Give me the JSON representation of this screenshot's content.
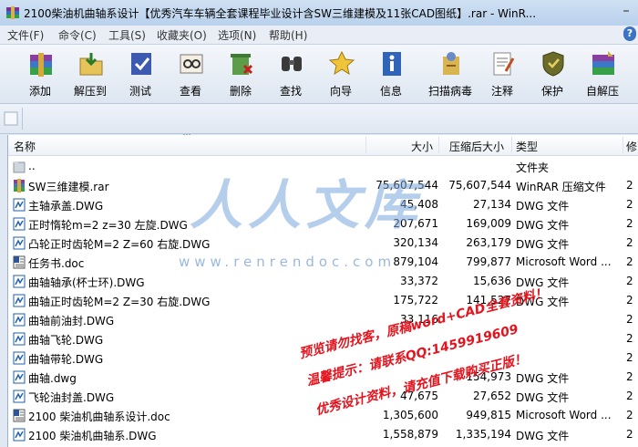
{
  "window": {
    "title": "2100柴油机曲轴系设计【优秀汽车车辆全套课程毕业设计含SW三维建模及11张CAD图纸】.rar - WinR..."
  },
  "menu": {
    "items": [
      "文件(F)",
      "命令(C)",
      "工具(S)",
      "收藏夹(O)",
      "选项(N)",
      "帮助(H)"
    ]
  },
  "toolbar": {
    "buttons": [
      {
        "label": "添加",
        "icon": "add-archive-icon"
      },
      {
        "label": "解压到",
        "icon": "extract-to-icon"
      },
      {
        "label": "测试",
        "icon": "test-icon"
      },
      {
        "label": "查看",
        "icon": "view-icon"
      },
      {
        "label": "删除",
        "icon": "delete-icon"
      },
      {
        "label": "查找",
        "icon": "find-icon"
      },
      {
        "label": "向导",
        "icon": "wizard-icon"
      },
      {
        "label": "信息",
        "icon": "info-icon"
      },
      {
        "label": "扫描病毒",
        "icon": "virus-scan-icon"
      },
      {
        "label": "注释",
        "icon": "comment-icon"
      },
      {
        "label": "保护",
        "icon": "protect-icon"
      },
      {
        "label": "自解压",
        "icon": "sfx-icon"
      }
    ]
  },
  "list": {
    "columns": {
      "name": "名称",
      "size": "大小",
      "packed": "压缩后大小",
      "type": "类型",
      "modified": "修"
    },
    "rows": [
      {
        "name": "..",
        "size": "",
        "packed": "",
        "type": "文件夹",
        "mod": "",
        "icon": "folder-up-icon"
      },
      {
        "name": "SW三维建模.rar",
        "size": "75,607,544",
        "packed": "75,607,544",
        "type": "WinRAR 压缩文件",
        "mod": "2",
        "icon": "rar-file-icon"
      },
      {
        "name": "主轴承盖.DWG",
        "size": "45,408",
        "packed": "27,134",
        "type": "DWG 文件",
        "mod": "2",
        "icon": "dwg-file-icon"
      },
      {
        "name": "正时惰轮m=2 z=30 左旋.DWG",
        "size": "207,671",
        "packed": "169,009",
        "type": "DWG 文件",
        "mod": "2",
        "icon": "dwg-file-icon"
      },
      {
        "name": "凸轮正时齿轮M=2 Z=60 右旋.DWG",
        "size": "320,134",
        "packed": "263,179",
        "type": "DWG 文件",
        "mod": "2",
        "icon": "dwg-file-icon"
      },
      {
        "name": "任务书.doc",
        "size": "879,104",
        "packed": "799,877",
        "type": "Microsoft Word ...",
        "mod": "2",
        "icon": "doc-file-icon"
      },
      {
        "name": "曲轴轴承(杯士环).DWG",
        "size": "33,372",
        "packed": "15,636",
        "type": "DWG 文件",
        "mod": "2",
        "icon": "dwg-file-icon"
      },
      {
        "name": "曲轴正时齿轮M=2 Z=30 右旋.DWG",
        "size": "175,722",
        "packed": "141,527",
        "type": "DWG 文件",
        "mod": "2",
        "icon": "dwg-file-icon"
      },
      {
        "name": "曲轴前油封.DWG",
        "size": "33,116",
        "packed": "",
        "type": "",
        "mod": "2",
        "icon": "dwg-file-icon"
      },
      {
        "name": "曲轴飞轮.DWG",
        "size": "",
        "packed": "",
        "type": "",
        "mod": "2",
        "icon": "dwg-file-icon"
      },
      {
        "name": "曲轴带轮.DWG",
        "size": "",
        "packed": "",
        "type": "",
        "mod": "2",
        "icon": "dwg-file-icon"
      },
      {
        "name": "曲轴.dwg",
        "size": "",
        "packed": "154,973",
        "type": "DWG 文件",
        "mod": "2",
        "icon": "dwg-file-icon"
      },
      {
        "name": "飞轮油封盖.DWG",
        "size": "47,675",
        "packed": "27,652",
        "type": "DWG 文件",
        "mod": "2",
        "icon": "dwg-file-icon"
      },
      {
        "name": "2100 柴油机曲轴系设计.doc",
        "size": "1,305,600",
        "packed": "949,815",
        "type": "Microsoft Word ...",
        "mod": "2",
        "icon": "doc-file-icon"
      },
      {
        "name": "2100 柴油机曲轴系.DWG",
        "size": "1,558,879",
        "packed": "1,335,194",
        "type": "DWG 文件",
        "mod": "2",
        "icon": "dwg-file-icon"
      }
    ]
  },
  "watermark": {
    "logo": "人人文库",
    "site": "www.renrendoc.com",
    "line1": "预览请勿找客，原稿word+CAD全套资料！",
    "line2": "温馨提示：请联系QQ:1459919609",
    "line3": "优秀设计资料，请充值下载购买正版！"
  },
  "colors": {
    "watermark_red": "#e4141e",
    "titlebar": "#c4d8f0"
  }
}
